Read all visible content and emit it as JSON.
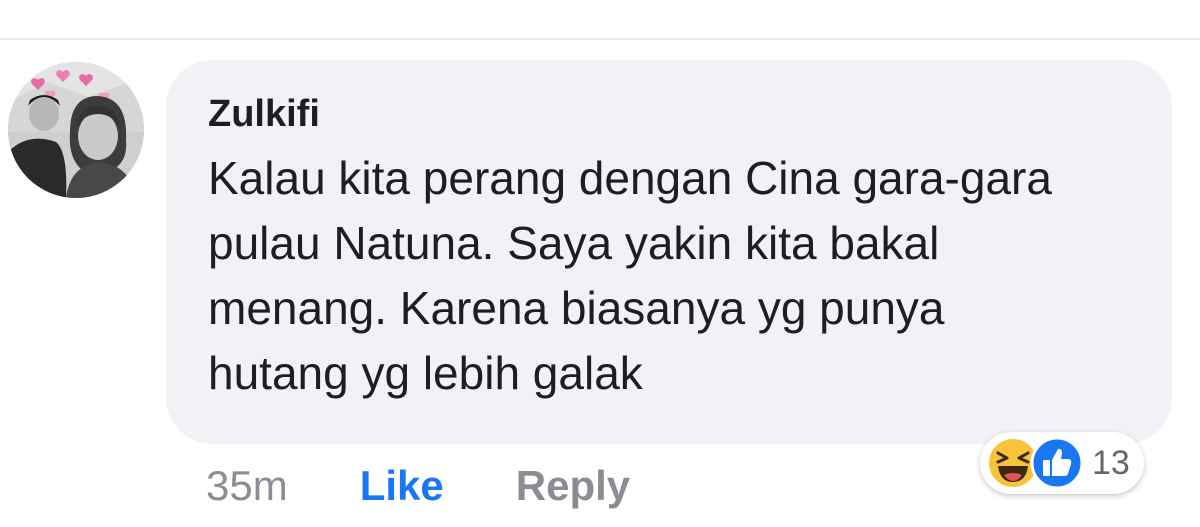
{
  "comment": {
    "author": "Zulkifi",
    "text": "Kalau kita perang dengan Cina gara-gara pulau Natuna. Saya yakin kita bakal menang. Karena biasanya yg punya hutang yg lebih galak",
    "time": "35m",
    "like_label": "Like",
    "reply_label": "Reply"
  },
  "reactions": {
    "icons": [
      "haha-icon",
      "like-icon"
    ],
    "count": "13"
  },
  "colors": {
    "bubble": "#f0f2f5",
    "text": "#1c1e21",
    "muted": "#8a8d91",
    "like_blue": "#1877f2",
    "haha_yellow": "#f7c33b"
  }
}
